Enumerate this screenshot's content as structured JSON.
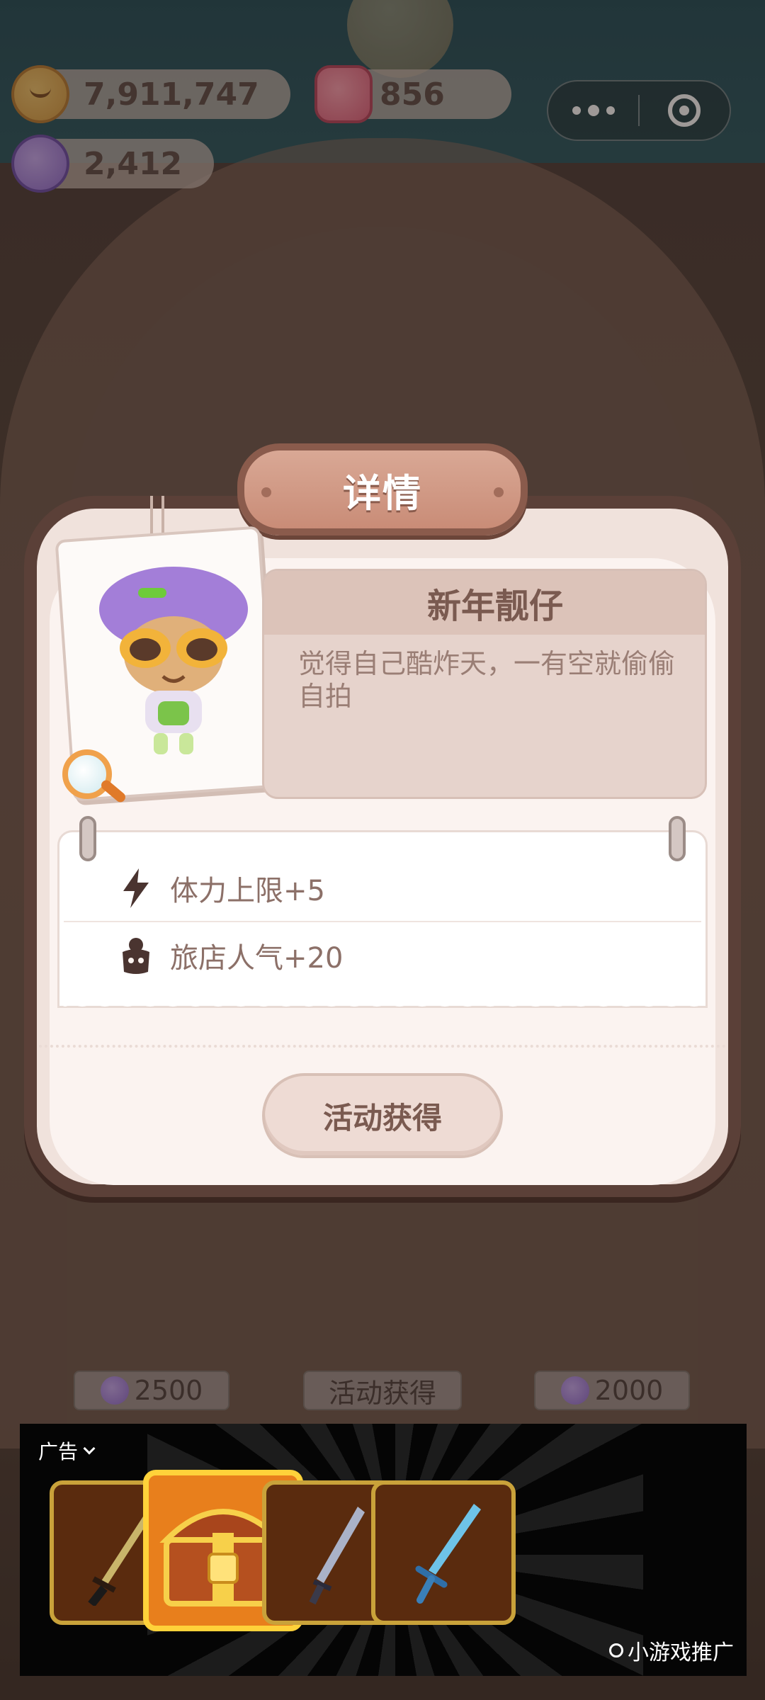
{
  "currency": {
    "coins": "7,911,747",
    "gems": "856",
    "candy": "2,412"
  },
  "shop_prices": {
    "left": "2500",
    "middle": "活动获得",
    "right": "2000"
  },
  "modal": {
    "title": "详情",
    "item_name": "新年靓仔",
    "item_description": "觉得自己酷炸天，一有空就偷偷自拍",
    "stats": [
      {
        "icon": "lightning-icon",
        "text": "体力上限+5"
      },
      {
        "icon": "popularity-icon",
        "text": "旅店人气+20"
      }
    ],
    "acquire_label": "活动获得"
  },
  "ad": {
    "label": "广告",
    "promo": "小游戏推广",
    "items": [
      "katana-icon",
      "treasure-chest-icon",
      "blade-icon",
      "sword-icon"
    ]
  },
  "colors": {
    "modal_border": "#5b4038",
    "modal_bg": "#fbf3f0",
    "header_pink": "#c98c77",
    "text_brown": "#7a5a50",
    "ad_gold": "#ffd23a"
  }
}
